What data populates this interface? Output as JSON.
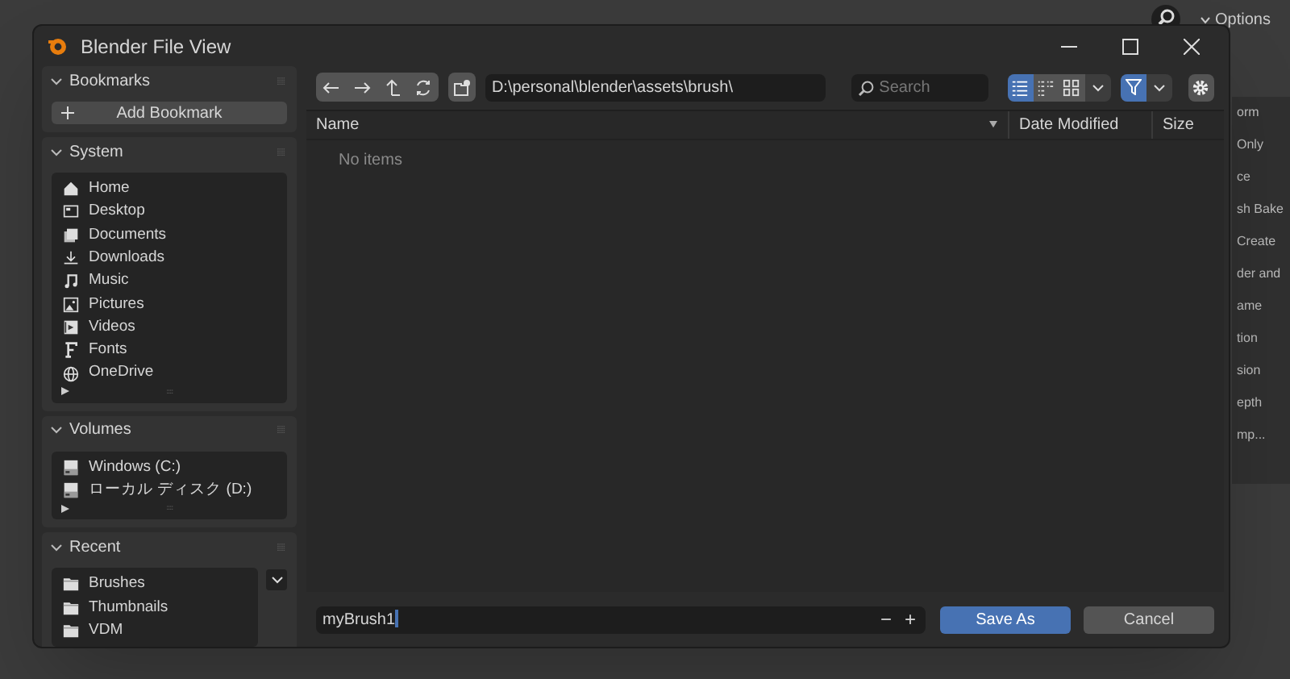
{
  "viewport": {
    "options_label": "Options",
    "panel_texts": [
      "orm",
      "Only",
      "ce",
      "sh Bake",
      "Create",
      "der and",
      "ame",
      "tion",
      "sion",
      "epth",
      "mp..."
    ]
  },
  "window": {
    "title": "Blender File View"
  },
  "sidebar": {
    "panels": [
      {
        "kind": "bookmarks",
        "title": "Bookmarks",
        "expanded": true,
        "button": "Add Bookmark"
      },
      {
        "kind": "list",
        "title": "System",
        "expanded": true,
        "items": [
          "Home",
          "Desktop",
          "Documents",
          "Downloads",
          "Music",
          "Pictures",
          "Videos",
          "Fonts",
          "OneDrive"
        ]
      },
      {
        "kind": "list",
        "title": "Volumes",
        "expanded": true,
        "items": [
          "Windows (C:)",
          "ローカル ディスク (D:)"
        ]
      },
      {
        "kind": "recent",
        "title": "Recent",
        "expanded": true,
        "items": [
          "Brushes",
          "Thumbnails",
          "VDM"
        ]
      }
    ]
  },
  "toolbar": {
    "path": "D:\\personal\\blender\\assets\\brush\\",
    "search": {
      "placeholder": "Search"
    },
    "view_modes": [
      {
        "selected": true
      },
      {
        "selected": false
      },
      {
        "selected": false
      }
    ],
    "filter_on": true
  },
  "file_list": {
    "columns": [
      "Name",
      "Date Modified",
      "Size"
    ],
    "empty_message": "No items"
  },
  "footer": {
    "filename": "myBrush1",
    "decrement": "−",
    "increment": "+",
    "buttons": [
      {
        "label": "Save As",
        "primary": true
      },
      {
        "label": "Cancel",
        "primary": false
      }
    ]
  }
}
